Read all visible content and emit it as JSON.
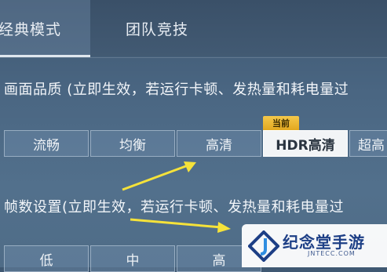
{
  "tabs": [
    {
      "label": "经典模式",
      "active": true
    },
    {
      "label": "团队竞技",
      "active": false
    }
  ],
  "quality": {
    "title": "画面品质 (立即生效，若运行卡顿、发热量和耗电量过",
    "options": [
      "流畅",
      "均衡",
      "高清",
      "HDR高清",
      "超高"
    ],
    "selected": "HDR高清",
    "badge": "当前"
  },
  "framerate": {
    "title": "帧数设置(立即生效，若运行卡顿、发热量和耗电量过",
    "options": [
      "低",
      "中",
      "高"
    ]
  },
  "watermark": {
    "title": "纪念堂手游",
    "subtitle": "JNTECC.COM"
  },
  "colors": {
    "accent_badge": "#e2a820",
    "arrow": "#f5e23a",
    "logo_blue": "#1d3f86"
  }
}
